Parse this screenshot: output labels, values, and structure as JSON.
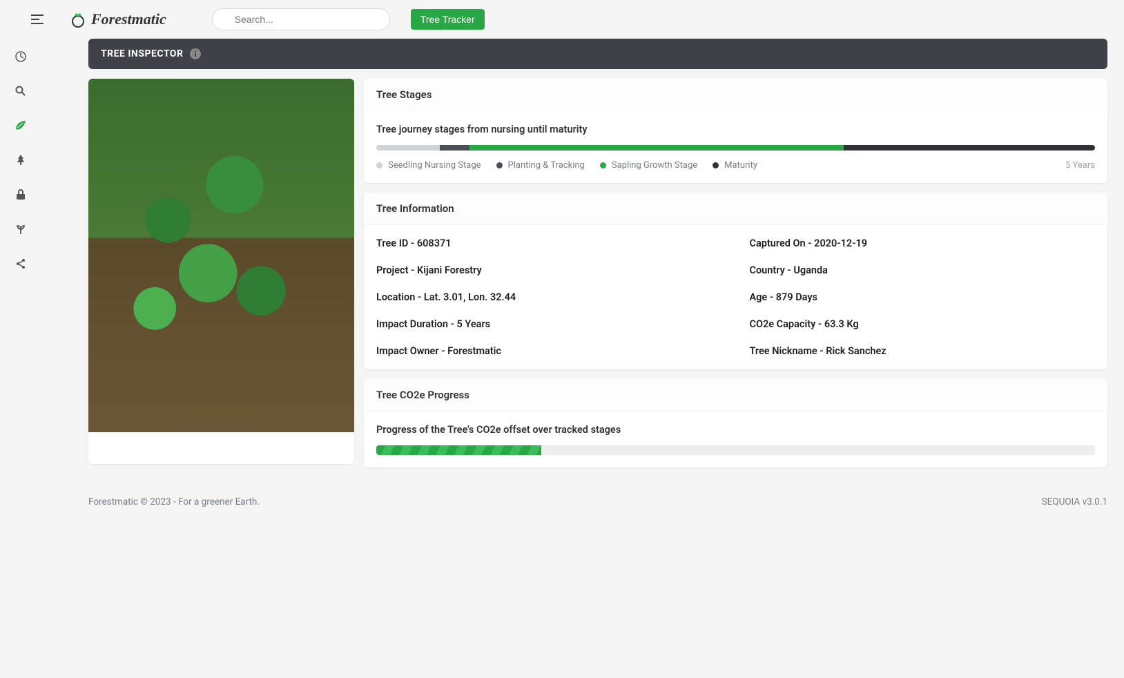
{
  "header": {
    "logo_text": "Forestmatic",
    "search_placeholder": "Search...",
    "tracker_button": "Tree Tracker"
  },
  "nav": {
    "items": [
      {
        "name": "dashboard-icon",
        "label": "Dashboard"
      },
      {
        "name": "search-nav-icon",
        "label": "Explore"
      },
      {
        "name": "leaf-icon",
        "label": "Trees"
      },
      {
        "name": "forest-icon",
        "label": "Forests"
      },
      {
        "name": "lock-icon",
        "label": "Security"
      },
      {
        "name": "sprout-icon",
        "label": "Growth"
      },
      {
        "name": "share-icon",
        "label": "Share"
      }
    ],
    "active_index": 2
  },
  "page": {
    "title": "TREE INSPECTOR"
  },
  "stages": {
    "card_title": "Tree Stages",
    "subtitle": "Tree journey stages from nursing until maturity",
    "segments": [
      {
        "key": "nursing",
        "label": "Seedling Nursing Stage",
        "width_pct": 8.8
      },
      {
        "key": "planting",
        "label": "Planting & Tracking",
        "width_pct": 4.2
      },
      {
        "key": "sapling",
        "label": "Sapling Growth Stage",
        "width_pct": 52
      },
      {
        "key": "maturity",
        "label": "Maturity",
        "width_pct": 35
      }
    ],
    "duration_label": "5 Years"
  },
  "info": {
    "card_title": "Tree Information",
    "rows": {
      "tree_id_k": "Tree ID",
      "tree_id_v": "608371",
      "captured_k": "Captured On",
      "captured_v": "2020-12-19",
      "project_k": "Project",
      "project_v": "Kijani Forestry",
      "country_k": "Country",
      "country_v": "Uganda",
      "location_k": "Location",
      "location_v": "Lat. 3.01, Lon. 32.44",
      "age_k": "Age",
      "age_v": "879 Days",
      "impact_dur_k": "Impact Duration",
      "impact_dur_v": "5 Years",
      "co2cap_k": "CO2e Capacity",
      "co2cap_v": "63.3 Kg",
      "owner_k": "Impact Owner",
      "owner_v": "Forestmatic",
      "nickname_k": "Tree Nickname",
      "nickname_v": "Rick Sanchez"
    }
  },
  "co2": {
    "card_title": "Tree CO2e Progress",
    "subtitle": "Progress of the Tree's CO2e offset over tracked stages",
    "progress_pct": 23
  },
  "footer": {
    "left": "Forestmatic © 2023 - For a greener Earth.",
    "right": "SEQUOIA v3.0.1"
  }
}
